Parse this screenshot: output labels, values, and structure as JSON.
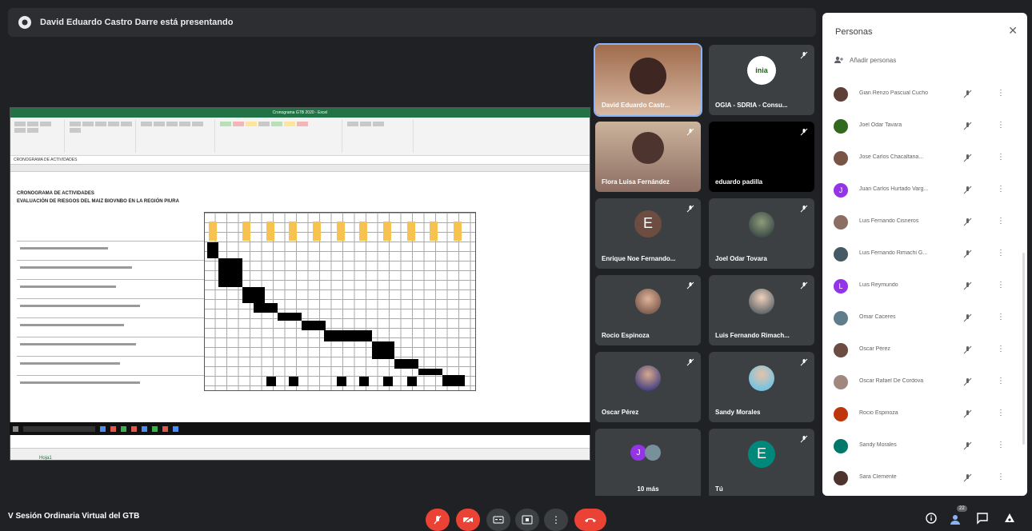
{
  "presenting": {
    "text": "David Eduardo Castro Darre está presentando"
  },
  "sheet": {
    "title_bar": "Cronograma GTB 2020 - Excel",
    "formula": "CRONOGRAMA DE ACTIVIDADES",
    "heading1": "CRONOGRAMA DE ACTIVIDADES",
    "heading2": "EVALUACIÓN DE RIESGOS DEL MAIZ BIOVNBO EN LA REGIÓN PIURA",
    "tab": "Hoja1"
  },
  "tiles": [
    {
      "name": "David Eduardo Castr...",
      "kind": "video",
      "active": true
    },
    {
      "name": "OGIA - SDRIA - Consu...",
      "kind": "logo"
    },
    {
      "name": "Flora Luisa Fernández",
      "kind": "video"
    },
    {
      "name": "eduardo padilla",
      "kind": "dark"
    },
    {
      "name": "Enrique Noe Fernando...",
      "kind": "letter",
      "letter": "E",
      "color": "#6d4c41"
    },
    {
      "name": "Joel Odar Tovara",
      "kind": "photo"
    },
    {
      "name": "Rocio Espinoza",
      "kind": "photo"
    },
    {
      "name": "Luis Fernando Rimach...",
      "kind": "photo"
    },
    {
      "name": "Oscar Pérez",
      "kind": "photo"
    },
    {
      "name": "Sandy Morales",
      "kind": "photo"
    },
    {
      "name": "10 más",
      "kind": "more"
    },
    {
      "name": "Tú",
      "kind": "letter",
      "letter": "E",
      "color": "#00897b"
    }
  ],
  "bottom": {
    "meeting_title": "V Sesión Ordinaria Virtual del GTB",
    "participants_count": "22"
  },
  "panel": {
    "title": "Personas",
    "add_label": "Añadir personas",
    "people": [
      {
        "name": "Gian Renzo Pascual Cucho",
        "color": "#5d4037"
      },
      {
        "name": "Joel Odar Tavara",
        "color": "#33691e"
      },
      {
        "name": "Jose Carlos Chacaltana...",
        "color": "#795548"
      },
      {
        "name": "Juan Carlos Hurtado Varg...",
        "color": "#9334e6",
        "letter": "J"
      },
      {
        "name": "Luis Fernando Cisneros",
        "color": "#8d6e63"
      },
      {
        "name": "Luis Fernando Rimachi G...",
        "color": "#455a64"
      },
      {
        "name": "Luis Reymundo",
        "color": "#9334e6",
        "letter": "L"
      },
      {
        "name": "Omar Caceres",
        "color": "#607d8b"
      },
      {
        "name": "Oscar Pérez",
        "color": "#6d4c41"
      },
      {
        "name": "Oscar Rafael De Cordova",
        "color": "#a1887f"
      },
      {
        "name": "Rocio Espinoza",
        "color": "#bf360c"
      },
      {
        "name": "Sandy Morales",
        "color": "#00796b"
      },
      {
        "name": "Sara Clemente",
        "color": "#4e342e"
      }
    ]
  }
}
